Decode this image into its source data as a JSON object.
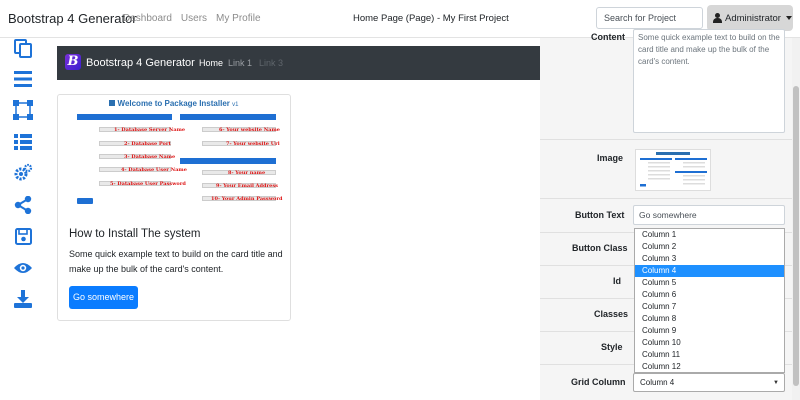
{
  "topbar": {
    "brand": "Bootstrap 4 Generator",
    "nav": [
      "Dashboard",
      "Users",
      "My Profile"
    ],
    "page_title": "Home Page (Page) - My First Project",
    "search_placeholder": "Search for Project",
    "user": "Administrator"
  },
  "sidebar": {
    "icons": [
      "copy-icon",
      "list-icon",
      "bezier-icon",
      "list-ul-icon",
      "cogs-icon",
      "share-icon",
      "save-icon",
      "eye-icon",
      "download-icon"
    ]
  },
  "preview": {
    "navbar": {
      "logo_letter": "B",
      "title": "Bootstrap 4 Generator",
      "links": [
        {
          "label": "Home",
          "state": "active"
        },
        {
          "label": "Link 1",
          "state": "normal"
        },
        {
          "label": "Link 3",
          "state": "disabled"
        }
      ]
    },
    "card": {
      "image": {
        "title": "Welcome to Package Installer",
        "version": "v1",
        "db_labels": [
          "1- Database Server Name",
          "2- Database Port",
          "3- Database Name",
          "4- Database User Name",
          "5- Database User Password"
        ],
        "site_labels": [
          "6- Your website Name",
          "7- Your website Url",
          "8- Your name",
          "9- Your Email Address",
          "10- Your Admin Password"
        ]
      },
      "title": "How to Install The system",
      "text": "Some quick example text to build on the card title and make up the bulk of the card's content.",
      "button": "Go somewhere"
    }
  },
  "properties": {
    "content_label": "Content",
    "content_value": "Some quick example text to build on the card title and make up the bulk of the card's content.",
    "image_label": "Image",
    "button_text_label": "Button Text",
    "button_text_value": "Go somewhere",
    "button_class_label": "Button Class",
    "id_label": "Id",
    "classes_label": "Classes",
    "style_label": "Style",
    "grid_column_label": "Grid Column",
    "grid_column_value": "Column 4",
    "grid_column_options": [
      "Column 1",
      "Column 2",
      "Column 3",
      "Column 4",
      "Column 5",
      "Column 6",
      "Column 7",
      "Column 8",
      "Column 9",
      "Column 10",
      "Column 11",
      "Column 12"
    ],
    "grid_column_highlighted": "Column 4"
  },
  "colors": {
    "primary": "#0a7cff",
    "navbar": "#343a40",
    "highlight": "#1e90ff",
    "sidebar_icon": "#1e73d8"
  }
}
